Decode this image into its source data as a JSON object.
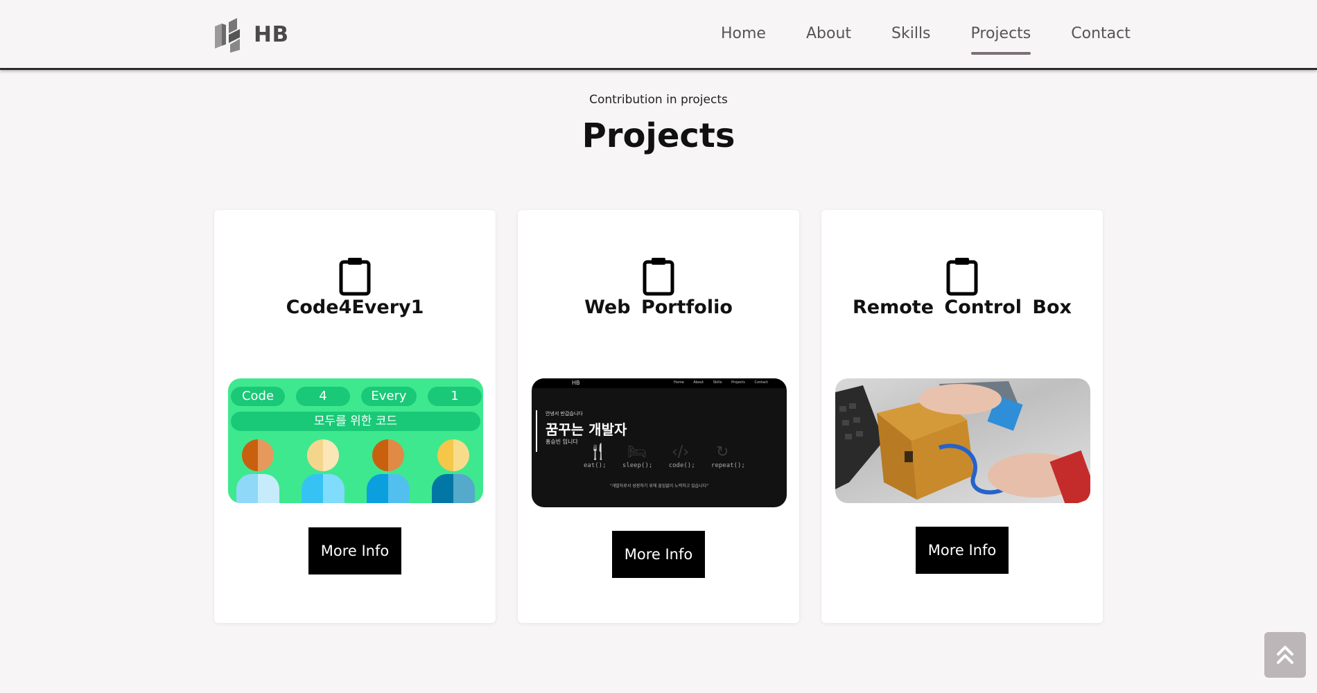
{
  "brand": {
    "name": "HB"
  },
  "nav": {
    "items": [
      "Home",
      "About",
      "Skills",
      "Projects",
      "Contact"
    ],
    "active": "Projects"
  },
  "section": {
    "subtitle": "Contribution in projects",
    "title": "Projects"
  },
  "projects": [
    {
      "title": "Code4Every1",
      "button": "More Info",
      "thumb": {
        "pills": [
          "Code",
          "4",
          "Every",
          "1"
        ],
        "banner": "모두를 위한 코드"
      }
    },
    {
      "title": "Web Portfolio",
      "button": "More Info",
      "thumb": {
        "brand": "HB",
        "links": "Home About Skills Projects Contact",
        "greeting": "안녕서 반갑습니다",
        "headline": "꿈꾸는 개발자",
        "name": "홍승빈 입니다",
        "actions": "eat(); sleep(); code(); repeat();",
        "quote": "\"개발자로서 성장하기 위해 끊임없이 노력하고 있습니다\""
      }
    },
    {
      "title": "Remote Control Box",
      "button": "More Info"
    }
  ],
  "colors": {
    "accent": "#7a6f76",
    "thumb1_bg": "#3ee88f",
    "button_bg": "#000000"
  },
  "icons": {
    "card": "clipboard-icon",
    "scroll_top": "double-chevron-up-icon"
  }
}
